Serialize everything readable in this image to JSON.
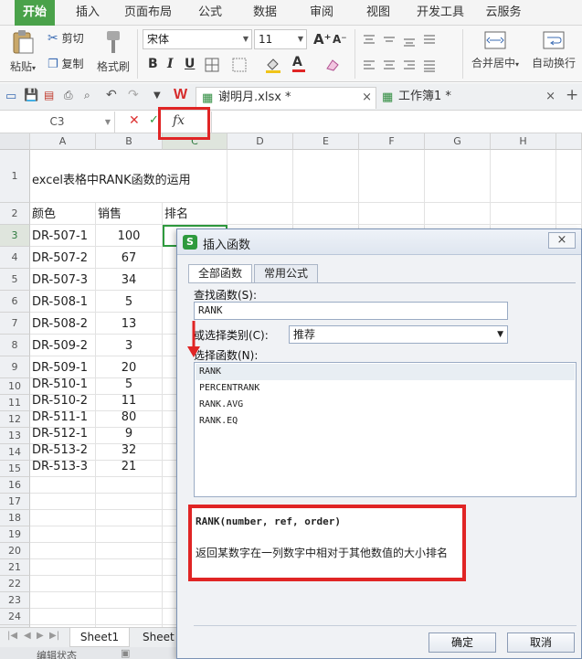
{
  "ribbon_tabs": [
    "开始",
    "插入",
    "页面布局",
    "公式",
    "数据",
    "审阅",
    "视图",
    "开发工具",
    "云服务"
  ],
  "ribbon": {
    "paste_label": "粘贴",
    "cut_label": "剪切",
    "copy_label": "复制",
    "format_painter_label": "格式刷",
    "font_name": "宋体",
    "font_size": "11",
    "bold": "B",
    "italic": "I",
    "underline": "U",
    "font_color_letter": "A",
    "grow_font": "A⁺",
    "shrink_font": "A⁻",
    "merge_label": "合并居中",
    "wrap_label": "自动换行"
  },
  "doc_tabs": {
    "file1": "谢明月.xlsx *",
    "file2": "工作簿1 *"
  },
  "formula_bar": {
    "name_box": "C3",
    "fx_label": "fx"
  },
  "grid": {
    "columns": [
      "A",
      "B",
      "C",
      "D",
      "E",
      "F",
      "G",
      "H"
    ],
    "rows": [
      "1",
      "2",
      "3",
      "4",
      "5",
      "6",
      "7",
      "8",
      "9",
      "10",
      "11",
      "12",
      "13",
      "14",
      "15",
      "16",
      "17",
      "18",
      "19",
      "20",
      "21",
      "22",
      "23",
      "24",
      "25"
    ],
    "title": "excel表格中RANK函数的运用",
    "headers": [
      "颜色",
      "销售",
      "排名"
    ],
    "data": [
      [
        "DR-507-1",
        "100"
      ],
      [
        "DR-507-2",
        "67"
      ],
      [
        "DR-507-3",
        "34"
      ],
      [
        "DR-508-1",
        "5"
      ],
      [
        "DR-508-2",
        "13"
      ],
      [
        "DR-509-2",
        "3"
      ],
      [
        "DR-509-1",
        "20"
      ],
      [
        "DR-510-1",
        "5"
      ],
      [
        "DR-510-2",
        "11"
      ],
      [
        "DR-511-1",
        "80"
      ],
      [
        "DR-512-1",
        "9"
      ],
      [
        "DR-513-2",
        "32"
      ],
      [
        "DR-513-3",
        "21"
      ]
    ]
  },
  "sheets": [
    "Sheet1",
    "Sheet"
  ],
  "status_text": "编辑状态",
  "dialog": {
    "title": "插入函数",
    "close": "×",
    "tabs": [
      "全部函数",
      "常用公式"
    ],
    "search_label": "查找函数(S):",
    "search_value": "RANK",
    "category_label": "或选择类别(C):",
    "category_value": "推荐",
    "select_label": "选择函数(N):",
    "functions": [
      "RANK",
      "PERCENTRANK",
      "RANK.AVG",
      "RANK.EQ"
    ],
    "signature": "RANK(number, ref, order)",
    "description": "返回某数字在一列数字中相对于其他数值的大小排名",
    "ok": "确定",
    "cancel": "取消"
  },
  "colors": {
    "active_tab": "#4aa24a",
    "highlight": "#e02525",
    "selection": "#2e9a3e"
  }
}
